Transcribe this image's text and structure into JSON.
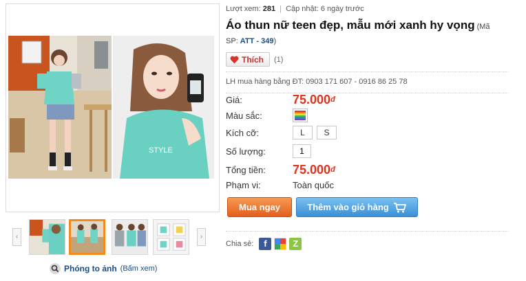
{
  "gallery": {
    "zoom_link": "Phóng to ảnh",
    "zoom_hint": "(Bấm xem)",
    "prev_arrow": "‹",
    "next_arrow": "›"
  },
  "meta": {
    "views_label": "Lượt xem:",
    "views_count": "281",
    "separator": "|",
    "updated": "Cập nhật: 6 ngày trước"
  },
  "product": {
    "title": "Áo thun nữ teen đẹp, mẫu mới xanh hy vọng",
    "code_prefix": "(Mã",
    "code_label": "SP:",
    "code_value": "ATT - 349",
    "code_suffix": ")"
  },
  "like": {
    "label": "Thích",
    "count": "(1)"
  },
  "contact": "LH mua hàng bằng ĐT: 0903 171 607 - 0916 86 25 78",
  "details": {
    "price_label": "Giá:",
    "price_value": "75.000",
    "currency": "đ",
    "color_label": "Màu sắc:",
    "size_label": "Kích cỡ:",
    "sizes": [
      "L",
      "S"
    ],
    "qty_label": "Số lượng:",
    "qty_value": "1",
    "total_label": "Tổng tiền:",
    "total_value": "75.000",
    "scope_label": "Phạm vi:",
    "scope_value": "Toàn quốc"
  },
  "actions": {
    "buy_now": "Mua ngay",
    "add_to_cart": "Thêm vào giỏ hàng"
  },
  "share": {
    "label": "Chia sẻ:",
    "facebook": "f",
    "zing": "Z"
  },
  "colors": {
    "price": "#e0331e",
    "buy": "#e8681f",
    "cart": "#4a9de0",
    "thumb_active": "#f28a1c",
    "link": "#1a4c86"
  }
}
